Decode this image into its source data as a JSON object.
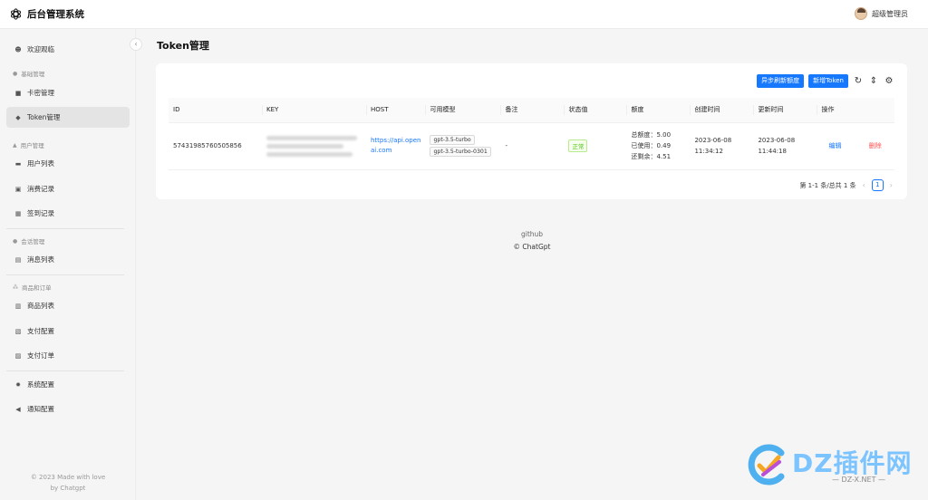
{
  "app": {
    "title": "后台管理系统",
    "user_name": "超级管理员"
  },
  "sidebar": {
    "items": [
      {
        "label": "欢迎观临",
        "icon": "smile-icon"
      },
      {
        "group": "基础管理",
        "icon": "user-icon"
      },
      {
        "label": "卡密管理",
        "icon": "lock-icon"
      },
      {
        "label": "Token管理",
        "icon": "shield-icon",
        "active": true
      },
      {
        "group": "用户管理",
        "icon": "home-icon"
      },
      {
        "label": "用户列表",
        "icon": "id-card-icon"
      },
      {
        "label": "消费记录",
        "icon": "wallet-icon"
      },
      {
        "label": "签到记录",
        "icon": "calendar-icon"
      },
      {
        "group": "会话管理",
        "icon": "chat-icon"
      },
      {
        "label": "消息列表",
        "icon": "file-icon"
      },
      {
        "group": "商品和订单",
        "icon": "cluster-icon"
      },
      {
        "label": "商品列表",
        "icon": "table-icon"
      },
      {
        "label": "支付配置",
        "icon": "bank-icon"
      },
      {
        "label": "支付订单",
        "icon": "order-icon"
      },
      {
        "label": "系统配置",
        "icon": "gear-icon"
      },
      {
        "label": "通知配置",
        "icon": "notification-icon"
      }
    ],
    "footer_line1": "© 2023 Made with love",
    "footer_line2": "by Chatgpt"
  },
  "page": {
    "title": "Token管理"
  },
  "toolbar": {
    "async_refresh_label": "异步刷新额度",
    "new_token_label": "新增Token"
  },
  "table": {
    "columns": [
      "ID",
      "KEY",
      "HOST",
      "可用模型",
      "备注",
      "状态值",
      "额度",
      "创建时间",
      "更新时间",
      "操作"
    ],
    "rows": [
      {
        "id": "57431985760505856",
        "host": "https://api.openai.com",
        "host_line1": "https://api.open",
        "host_line2": "ai.com",
        "models": [
          "gpt-3.5-turbo",
          "gpt-3.5-turbo-0301"
        ],
        "remark": "-",
        "status": "正常",
        "quota_total": "总额度：5.00",
        "quota_used": "已使用：0.49",
        "quota_left": "还剩余：4.51",
        "created_date": "2023-06-08",
        "created_time": "11:34:12",
        "updated_date": "2023-06-08",
        "updated_time": "11:44:18",
        "edit_label": "编辑",
        "delete_label": "删除"
      }
    ]
  },
  "pagination": {
    "summary": "第 1-1 条/总共 1 条",
    "current_page": "1"
  },
  "footer": {
    "link": "github",
    "copyright": "ChatGpt"
  },
  "watermark": {
    "main": "DZ插件网",
    "sub": "— DZ-X.NET —"
  },
  "colors": {
    "primary": "#1677ff",
    "danger": "#ff4d4f",
    "success": "#52c41a"
  }
}
